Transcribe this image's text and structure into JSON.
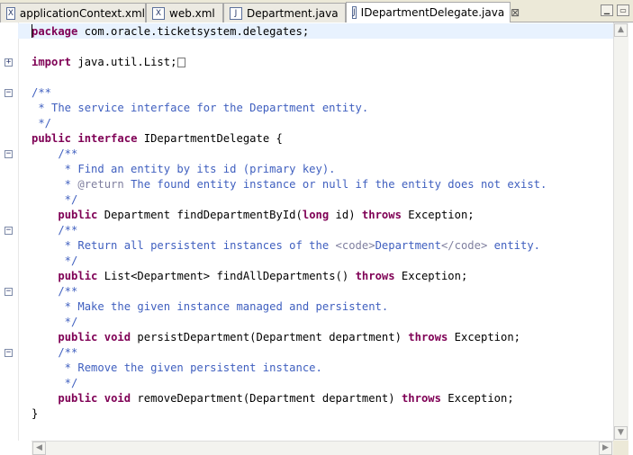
{
  "tabs": [
    {
      "icon": "xml-file-icon",
      "glyph": "X",
      "label": "applicationContext.xml"
    },
    {
      "icon": "xml-file-icon",
      "glyph": "X",
      "label": "web.xml"
    },
    {
      "icon": "java-file-icon",
      "glyph": "J",
      "label": "Department.java"
    },
    {
      "icon": "java-file-icon",
      "glyph": "J",
      "label": "IDepartmentDelegate.java",
      "active": true,
      "close_glyph": "⊠"
    }
  ],
  "window_buttons": {
    "minimize": "▁",
    "maximize": "▭"
  },
  "scrollbars": {
    "up": "▲",
    "down": "▼",
    "left": "◀",
    "right": "▶"
  },
  "fold_glyphs": {
    "collapsed": "+",
    "expanded": "−"
  },
  "code": {
    "package_kw": "package",
    "package_rest": " com.oracle.ticketsystem.delegates;",
    "import_kw": "import",
    "import_rest": " java.util.List;",
    "cls_doc_open": "/**",
    "cls_doc_body": " * The service interface for the Department entity.",
    "cls_doc_close": " */",
    "iface_kw1": "public",
    "iface_kw2": "interface",
    "iface_rest": " IDepartmentDelegate {",
    "m1_doc_open": "    /**",
    "m1_doc_l1": "     * Find an entity by its id (primary key).",
    "m1_doc_l2_star": "     * ",
    "m1_doc_l2_tag": "@return",
    "m1_doc_l2_rest": " The found entity instance or null if the entity does not exist.",
    "m1_doc_close": "     */",
    "m1_indent": "    ",
    "m1_kw1": "public",
    "m1_mid": " Department findDepartmentById(",
    "m1_kw2": "long",
    "m1_mid2": " id) ",
    "m1_kw3": "throws",
    "m1_end": " Exception;",
    "m2_doc_open": "    /**",
    "m2_doc_l1a": "     * Return all persistent instances of the ",
    "m2_doc_tag1": "<code>",
    "m2_doc_l1b": "Department",
    "m2_doc_tag2": "</code>",
    "m2_doc_l1c": " entity.",
    "m2_doc_close": "     */",
    "m2_indent": "    ",
    "m2_kw1": "public",
    "m2_mid": " List<Department> findAllDepartments() ",
    "m2_kw2": "throws",
    "m2_end": " Exception;",
    "m3_doc_open": "    /**",
    "m3_doc_l1": "     * Make the given instance managed and persistent.",
    "m3_doc_close": "     */",
    "m3_indent": "    ",
    "m3_kw1": "public",
    "m3_kw2": "void",
    "m3_mid": " persistDepartment(Department department) ",
    "m3_kw3": "throws",
    "m3_end": " Exception;",
    "m4_doc_open": "    /**",
    "m4_doc_l1": "     * Remove the given persistent instance.",
    "m4_doc_close": "     */",
    "m4_indent": "    ",
    "m4_kw1": "public",
    "m4_kw2": "void",
    "m4_mid": " removeDepartment(Department department) ",
    "m4_kw3": "throws",
    "m4_end": " Exception;",
    "close_brace": "}"
  },
  "colors": {
    "keyword": "#7f0055",
    "javadoc": "#3f5fbf",
    "javadoc_tag": "#7f7f9f",
    "current_line": "#e8f2fe"
  }
}
